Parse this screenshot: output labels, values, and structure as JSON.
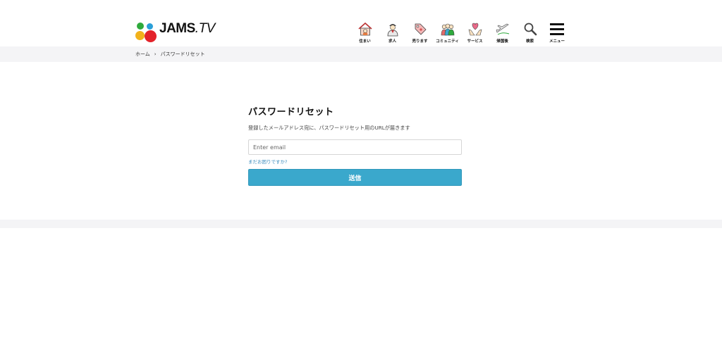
{
  "header": {
    "logo": {
      "brand": "JAMS",
      "suffix": ".TV"
    },
    "nav": [
      {
        "label": "住まい",
        "icon": "house-icon"
      },
      {
        "label": "求人",
        "icon": "worker-icon"
      },
      {
        "label": "売ります",
        "icon": "price-tag-icon"
      },
      {
        "label": "コミュニティ",
        "icon": "people-icon"
      },
      {
        "label": "サービス",
        "icon": "heart-hands-icon"
      },
      {
        "label": "帰国後",
        "icon": "airplane-icon"
      },
      {
        "label": "検索",
        "icon": "search-icon"
      },
      {
        "label": "メニュー",
        "icon": "hamburger-menu-icon"
      }
    ]
  },
  "breadcrumb": {
    "home": "ホーム",
    "separator": "›",
    "current": "パスワードリセット"
  },
  "form": {
    "title": "パスワードリセット",
    "description": "登録したメールアドレス宛に、パスワードリセット用のURLが届きます",
    "email_placeholder": "Enter email",
    "help_link": "まだお困りですか?",
    "submit_label": "送信"
  },
  "colors": {
    "accent": "#3aa8cc",
    "link": "#3a8bbd",
    "band": "#f4f4f6"
  }
}
